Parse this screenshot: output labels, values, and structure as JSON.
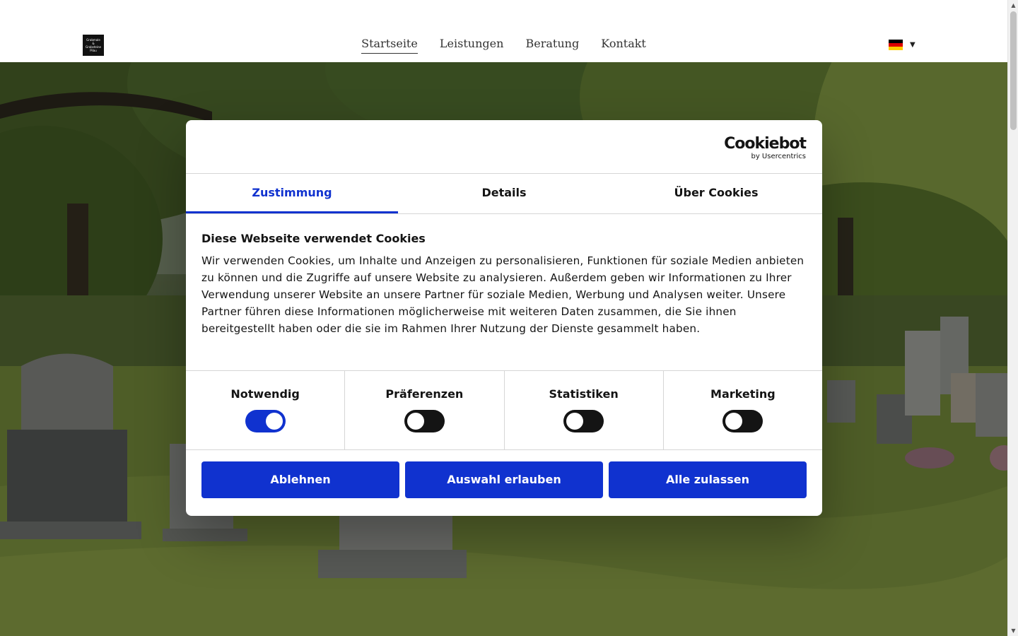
{
  "header": {
    "logo_lines": [
      "Grabmale",
      "&",
      "Grabsteine",
      "Pilau"
    ],
    "nav": [
      {
        "label": "Startseite",
        "active": true
      },
      {
        "label": "Leistungen",
        "active": false
      },
      {
        "label": "Beratung",
        "active": false
      },
      {
        "label": "Kontakt",
        "active": false
      }
    ],
    "language": {
      "flag_colors": [
        "#000000",
        "#dd0000",
        "#ffce00"
      ],
      "caret": "▼"
    }
  },
  "cookie_dialog": {
    "brand": "Cookiebot",
    "brand_sub": "by Usercentrics",
    "tabs": [
      {
        "label": "Zustimmung",
        "active": true
      },
      {
        "label": "Details",
        "active": false
      },
      {
        "label": "Über Cookies",
        "active": false
      }
    ],
    "title": "Diese Webseite verwendet Cookies",
    "text": "Wir verwenden Cookies, um Inhalte und Anzeigen zu personalisieren, Funktionen für soziale Medien anbieten zu können und die Zugriffe auf unsere Website zu analysieren. Außerdem geben wir Informationen zu Ihrer Verwendung unserer Website an unsere Partner für soziale Medien, Werbung und Analysen weiter. Unsere Partner führen diese Informationen möglicherweise mit weiteren Daten zusammen, die Sie ihnen bereitgestellt haben oder die sie im Rahmen Ihrer Nutzung der Dienste gesammelt haben.",
    "toggles": [
      {
        "label": "Notwendig",
        "on": true
      },
      {
        "label": "Präferenzen",
        "on": false
      },
      {
        "label": "Statistiken",
        "on": false
      },
      {
        "label": "Marketing",
        "on": false
      }
    ],
    "buttons": {
      "decline": "Ablehnen",
      "allow_selection": "Auswahl erlauben",
      "allow_all": "Alle zulassen"
    },
    "accent_color": "#1032cf"
  }
}
